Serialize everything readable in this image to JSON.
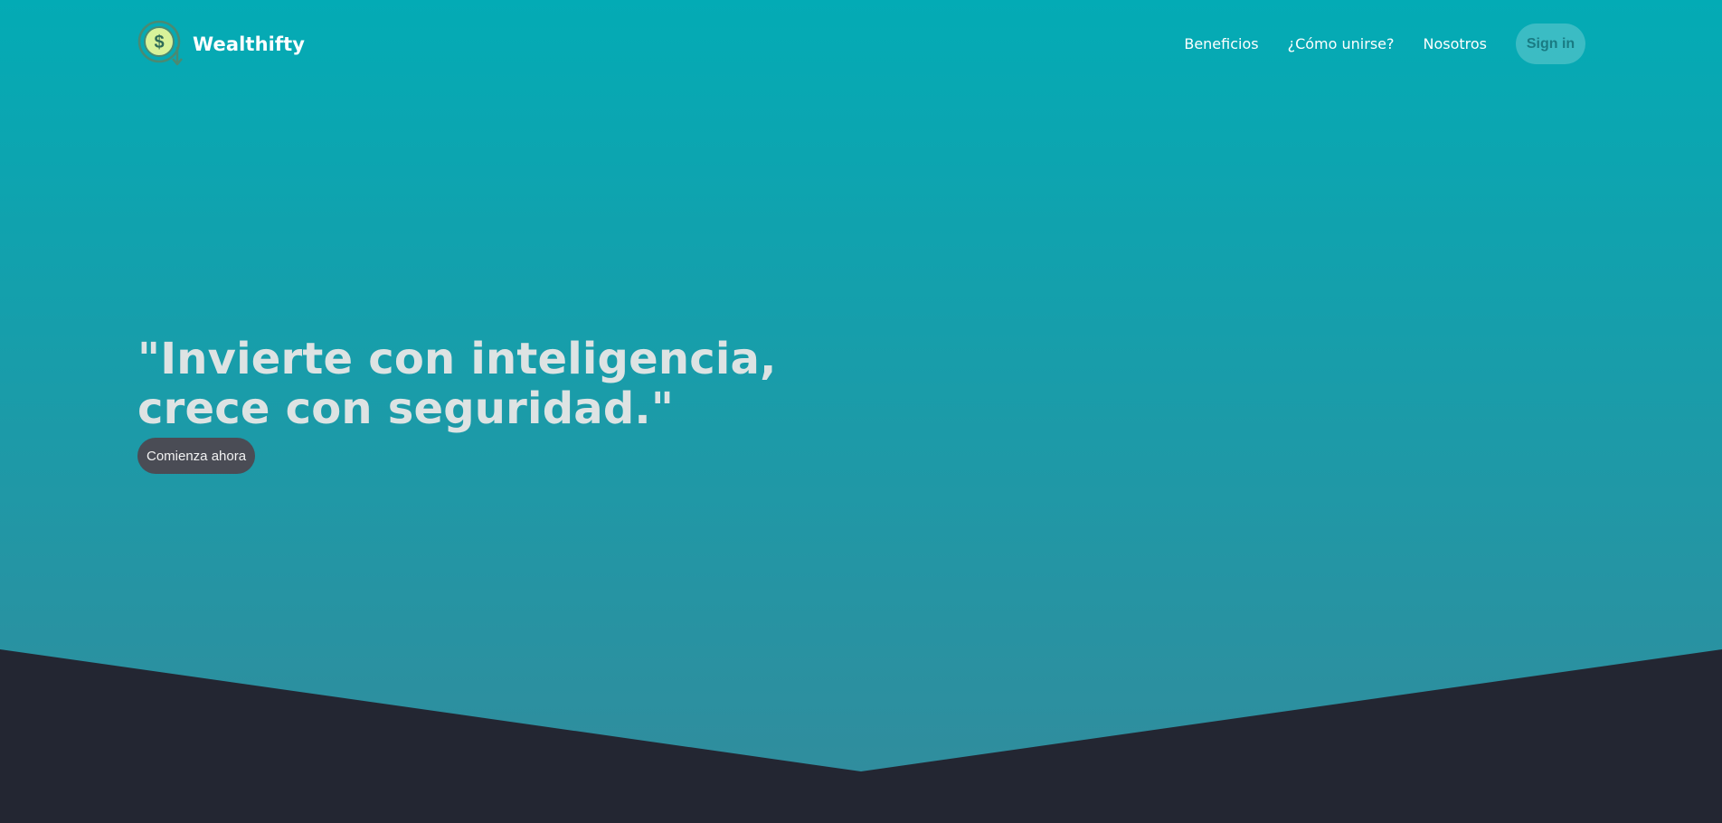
{
  "theme": {
    "gradient_top": "#03abb5",
    "gradient_bottom": "#338b9c",
    "wedge_color": "#232632",
    "cta_background": "#4a4c55",
    "signin_text": "#197b83",
    "logo_coin": "#d8f29a",
    "logo_ring": "#4a8a73"
  },
  "navbar": {
    "brand_name": "Wealthifty",
    "logo_icon": "dollar-coin-icon",
    "links": [
      {
        "label": "Beneficios"
      },
      {
        "label": "¿Cómo unirse?"
      },
      {
        "label": "Nosotros"
      }
    ],
    "signin_label": "Sign in"
  },
  "hero": {
    "headline_line1": "\"Invierte con inteligencia,",
    "headline_line2": "crece con seguridad.\"",
    "cta_label": "Comienza ahora"
  }
}
